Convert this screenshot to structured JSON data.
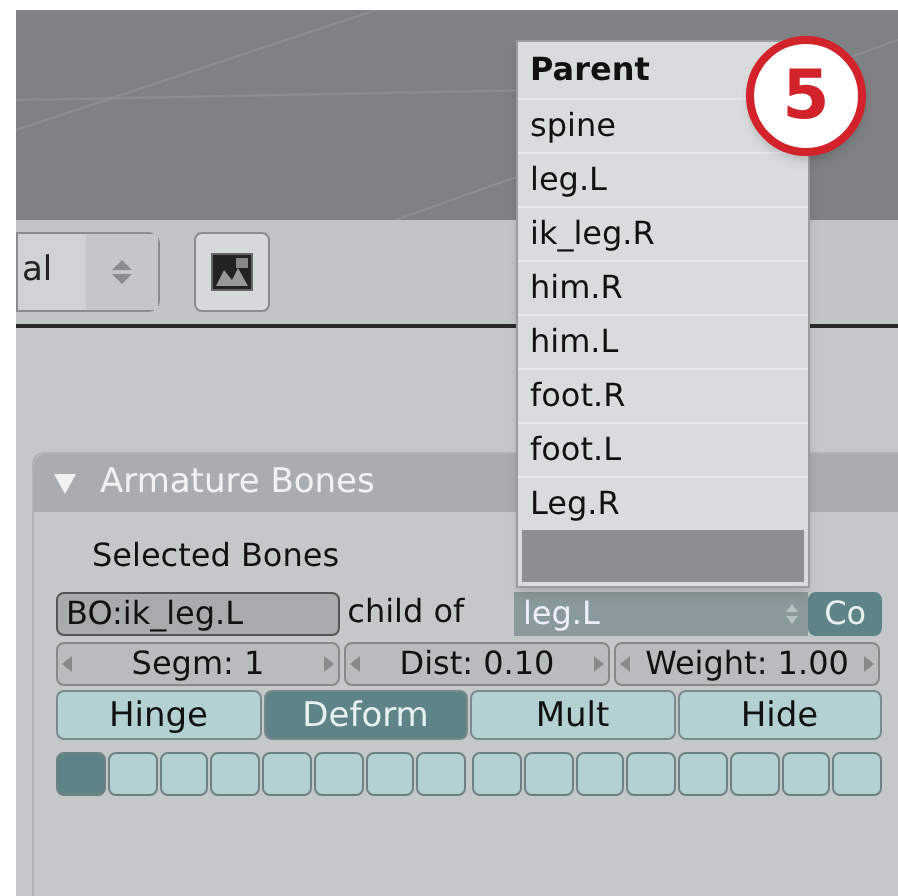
{
  "header": {
    "mode_dropdown": {
      "value": "al"
    }
  },
  "parent_menu": {
    "title": "Parent",
    "items": [
      {
        "label": "spine"
      },
      {
        "label": "leg.L"
      },
      {
        "label": "ik_leg.R"
      },
      {
        "label": "him.R"
      },
      {
        "label": "him.L"
      },
      {
        "label": "foot.R"
      },
      {
        "label": "foot.L"
      },
      {
        "label": "Leg.R"
      }
    ]
  },
  "step_badge": "5",
  "panel": {
    "title": "Armature Bones",
    "expanded": true,
    "section_label": "Selected Bones",
    "bone_name": "BO:ik_leg.L",
    "child_of_label": "child of",
    "parent_field": "leg.L",
    "connect_button": {
      "label": "Co",
      "selected": true
    },
    "numbers": [
      {
        "label": "Segm: 1"
      },
      {
        "label": "Dist: 0.10"
      },
      {
        "label": "Weight: 1.00"
      }
    ],
    "toggles": [
      {
        "label": "Hinge",
        "selected": false
      },
      {
        "label": "Deform",
        "selected": true
      },
      {
        "label": "Mult",
        "selected": false
      },
      {
        "label": "Hide",
        "selected": false
      }
    ],
    "layers": [
      {
        "on": true
      },
      {
        "on": false
      },
      {
        "on": false
      },
      {
        "on": false
      },
      {
        "on": false
      },
      {
        "on": false
      },
      {
        "on": false
      },
      {
        "on": false
      },
      {
        "on": false
      },
      {
        "on": false
      },
      {
        "on": false
      },
      {
        "on": false
      },
      {
        "on": false
      },
      {
        "on": false
      },
      {
        "on": false
      },
      {
        "on": false
      }
    ]
  }
}
